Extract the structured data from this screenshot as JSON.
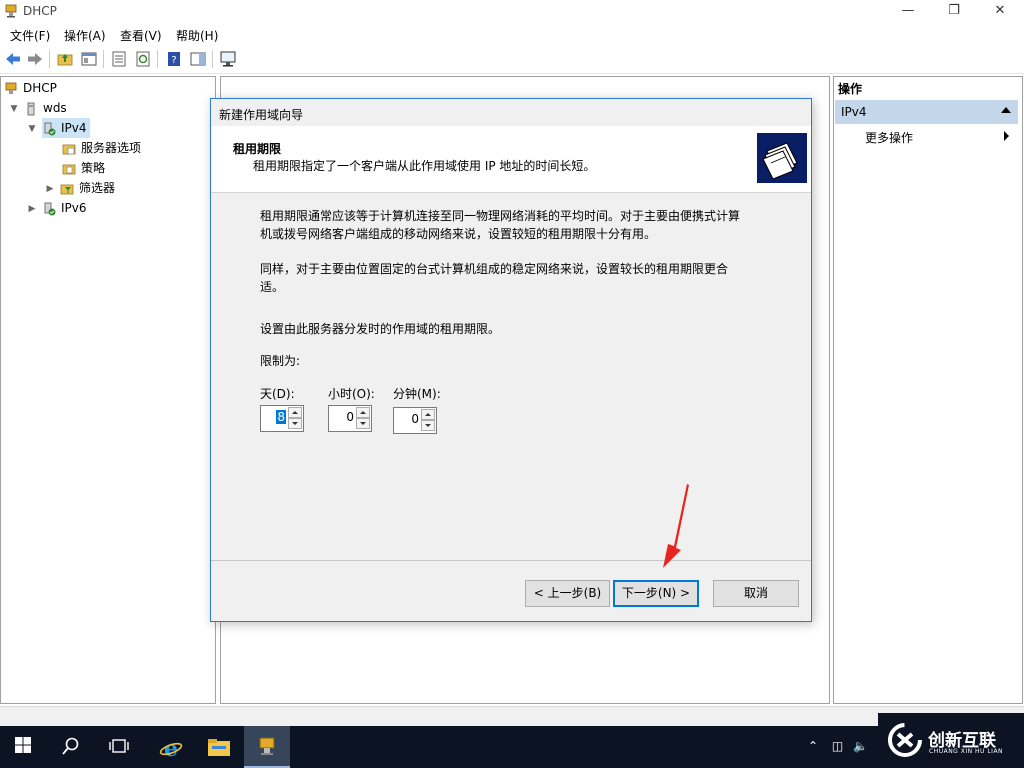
{
  "window": {
    "title": "DHCP"
  },
  "menu": [
    "文件(F)",
    "操作(A)",
    "查看(V)",
    "帮助(H)"
  ],
  "tree": {
    "root": "DHCP",
    "server": "wds",
    "ipv4": "IPv4",
    "server_options": "服务器选项",
    "policies": "策略",
    "filters": "筛选器",
    "ipv6": "IPv6"
  },
  "actions": {
    "header": "操作",
    "group": "IPv4",
    "more": "更多操作"
  },
  "dialog": {
    "title": "新建作用域向导",
    "heading": "租用期限",
    "subheading": "租用期限指定了一个客户端从此作用域使用 IP 地址的时间长短。",
    "para1_line1": "租用期限通常应该等于计算机连接至同一物理网络消耗的平均时间。对于主要由便携式计算",
    "para1_line2": "机或拨号网络客户端组成的移动网络来说，设置较短的租用期限十分有用。",
    "para2_line1": "同样，对于主要由位置固定的台式计算机组成的稳定网络来说，设置较长的租用期限更合",
    "para2_line2": "适。",
    "set_text": "设置由此服务器分发时的作用域的租用期限。",
    "limit_label": "限制为:",
    "days_label": "天(D):",
    "days_value": "8",
    "hours_label": "小时(O):",
    "hours_value": "0",
    "minutes_label": "分钟(M):",
    "minutes_value": "0",
    "back_button": "< 上一步(B)",
    "next_button": "下一步(N) >",
    "cancel_button": "取消"
  },
  "watermark": {
    "name": "创新互联",
    "sub": "CHUANG XIN HU LIAN"
  },
  "colors": {
    "accent": "#0078d7",
    "dialog_border": "#2b79d3",
    "actions_group_bg": "#c3d6ea",
    "taskbar": "#0c1424",
    "annotation": "#e8251e"
  }
}
